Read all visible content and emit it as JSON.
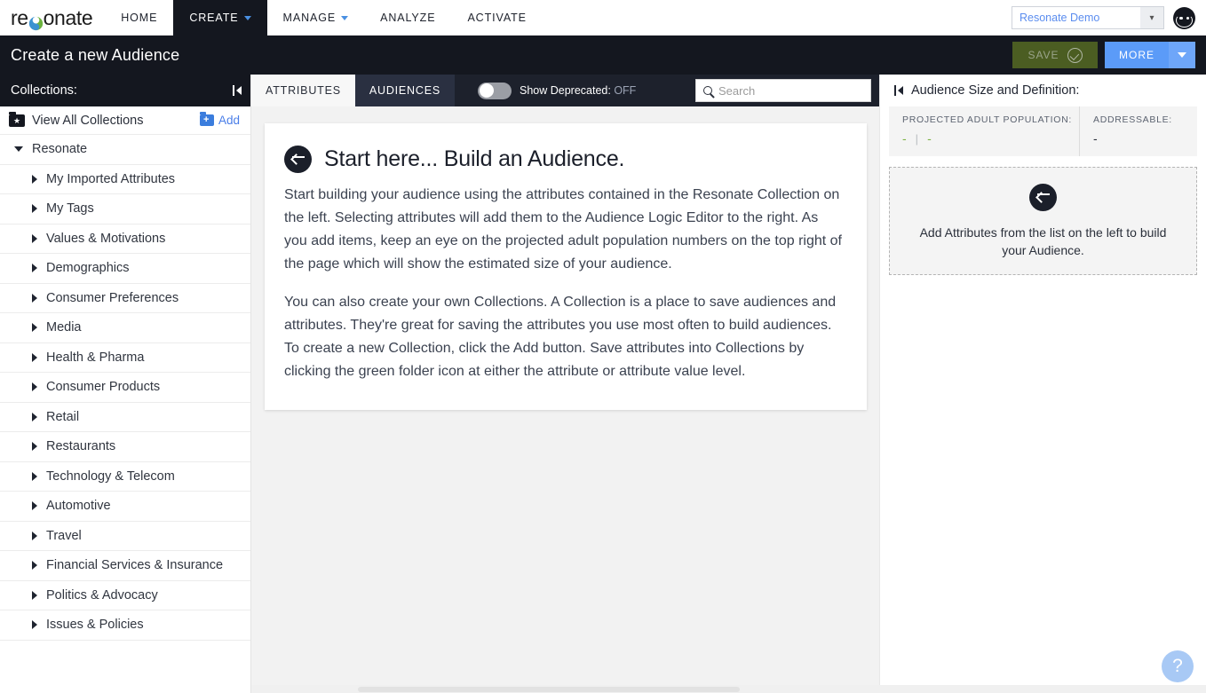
{
  "brand": {
    "logo_text_1": "re",
    "logo_text_2": "onate",
    "logo_icon": "resonate-yin-yang-s"
  },
  "topnav": {
    "items": [
      {
        "label": "HOME",
        "has_caret": false,
        "active": false
      },
      {
        "label": "CREATE",
        "has_caret": true,
        "active": true
      },
      {
        "label": "MANAGE",
        "has_caret": true,
        "active": false
      },
      {
        "label": "ANALYZE",
        "has_caret": false,
        "active": false
      },
      {
        "label": "ACTIVATE",
        "has_caret": false,
        "active": false
      }
    ],
    "account_select": "Resonate Demo",
    "avatar_icon": "user-avatar-icon"
  },
  "titlebar": {
    "title": "Create a new Audience",
    "save_label": "SAVE",
    "save_icon": "check-circle-icon",
    "more_label": "MORE",
    "more_caret_icon": "caret-down-icon"
  },
  "sidebar": {
    "header": "Collections:",
    "collapse_icon": "collapse-left-icon",
    "view_all_label": "View All Collections",
    "view_all_icon": "folder-star-icon",
    "add_label": "Add",
    "add_icon": "folder-plus-icon",
    "tree": [
      {
        "label": "Resonate",
        "level": "root",
        "expanded": true
      },
      {
        "label": "My Imported Attributes",
        "level": "child",
        "expanded": false
      },
      {
        "label": "My Tags",
        "level": "child",
        "expanded": false
      },
      {
        "label": "Values & Motivations",
        "level": "child",
        "expanded": false
      },
      {
        "label": "Demographics",
        "level": "child",
        "expanded": false
      },
      {
        "label": "Consumer Preferences",
        "level": "child",
        "expanded": false
      },
      {
        "label": "Media",
        "level": "child",
        "expanded": false
      },
      {
        "label": "Health & Pharma",
        "level": "child",
        "expanded": false
      },
      {
        "label": "Consumer Products",
        "level": "child",
        "expanded": false
      },
      {
        "label": "Retail",
        "level": "child",
        "expanded": false
      },
      {
        "label": "Restaurants",
        "level": "child",
        "expanded": false
      },
      {
        "label": "Technology & Telecom",
        "level": "child",
        "expanded": false
      },
      {
        "label": "Automotive",
        "level": "child",
        "expanded": false
      },
      {
        "label": "Travel",
        "level": "child",
        "expanded": false
      },
      {
        "label": "Financial Services & Insurance",
        "level": "child",
        "expanded": false
      },
      {
        "label": "Politics & Advocacy",
        "level": "child",
        "expanded": false
      },
      {
        "label": "Issues & Policies",
        "level": "child",
        "expanded": false
      }
    ]
  },
  "tabbar": {
    "tabs": [
      {
        "label": "ATTRIBUTES",
        "active": true
      },
      {
        "label": "AUDIENCES",
        "active": false
      }
    ],
    "toggle_label": "Show Deprecated:",
    "toggle_state": "OFF",
    "search_placeholder": "Search",
    "search_value": "",
    "search_icon": "search-icon"
  },
  "intro": {
    "back_icon": "circle-arrow-left-icon",
    "title": "Start here... Build an Audience.",
    "paragraph_1": "Start building your audience using the attributes contained in the Resonate Collection on the left. Selecting attributes will add them to the Audience Logic Editor to the right. As you add items, keep an eye on the projected adult population numbers on the top right of the page which will show the estimated size of your audience.",
    "paragraph_2": "You can also create your own Collections. A Collection is a place to save audiences and attributes. They're great for saving the attributes you use most often to build audiences. To create a new Collection, click the Add button. Save attributes into Collections by clicking the green folder icon at either the attribute or attribute value level."
  },
  "rightpanel": {
    "collapse_icon": "collapse-left-icon",
    "title": "Audience Size and Definition:",
    "stat_population_label": "PROJECTED ADULT POPULATION:",
    "stat_population_value_1": "-",
    "stat_population_divider": "|",
    "stat_population_value_2": "-",
    "stat_addressable_label": "ADDRESSABLE:",
    "stat_addressable_value": "-",
    "dropzone_icon": "circle-arrow-left-icon",
    "dropzone_text": "Add Attributes from the list on the left to build your Audience."
  },
  "help": {
    "label": "?",
    "icon": "help-question-icon"
  },
  "colors": {
    "brand_dark": "#14171f",
    "accent_blue": "#5b9bf8",
    "link_blue": "#4a7ee8",
    "save_green": "#4b5d22",
    "stat_green": "#7cb342",
    "panel_bg": "#f2f2f2"
  }
}
